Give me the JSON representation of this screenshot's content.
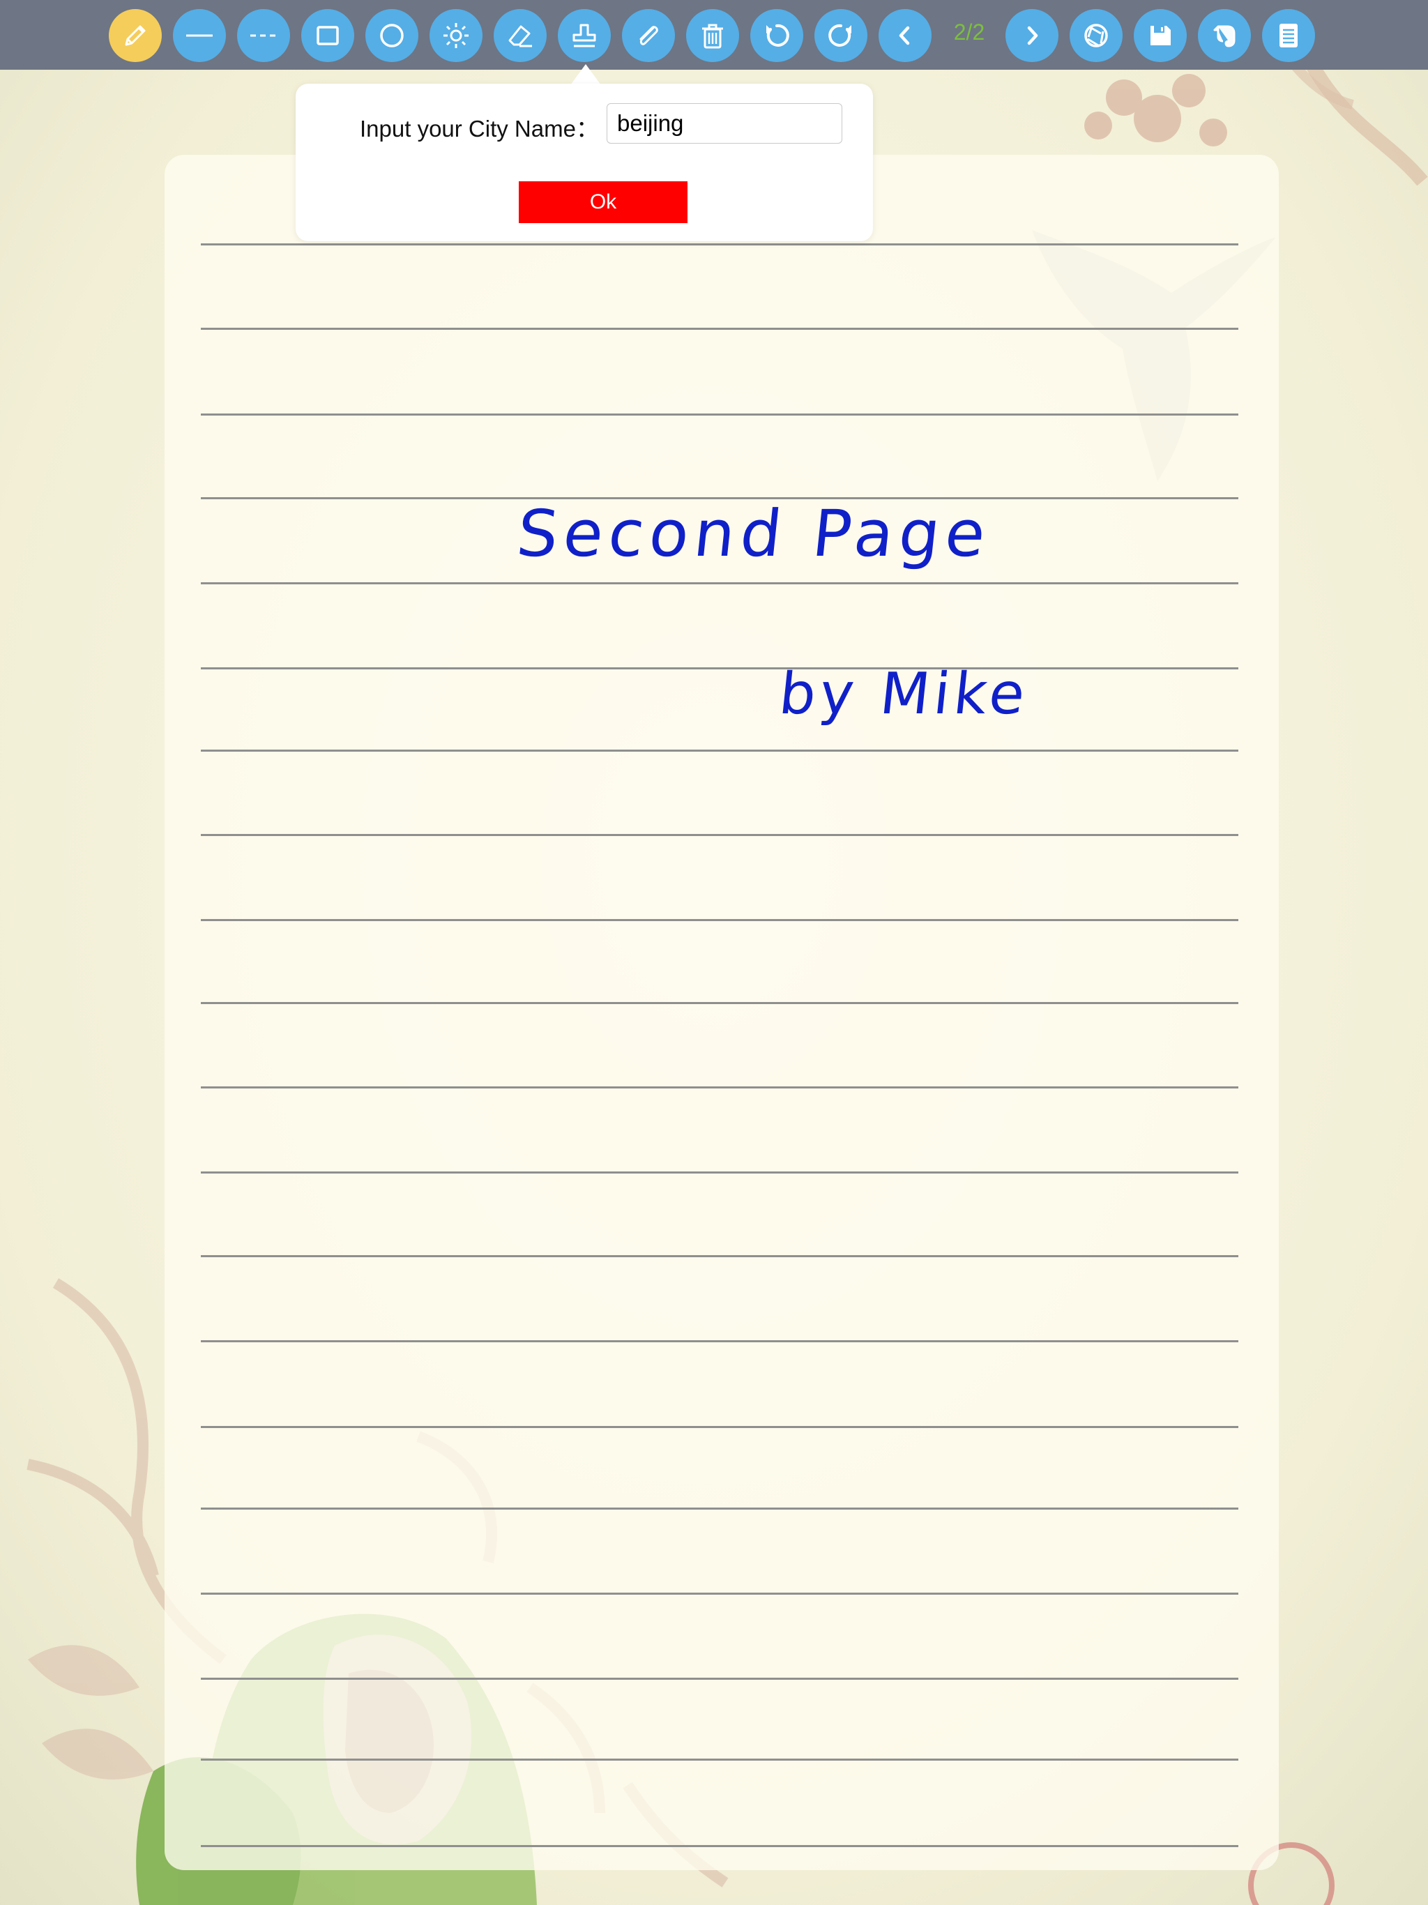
{
  "toolbar": {
    "buttons": [
      {
        "icon": "pencil-icon",
        "active": true
      },
      {
        "icon": "solid-line-icon"
      },
      {
        "icon": "dashed-line-icon"
      },
      {
        "icon": "rectangle-icon"
      },
      {
        "icon": "circle-icon"
      },
      {
        "icon": "brightness-icon"
      },
      {
        "icon": "eraser-icon"
      },
      {
        "icon": "stamp-icon"
      },
      {
        "icon": "paperclip-icon"
      },
      {
        "icon": "trash-icon"
      },
      {
        "icon": "undo-icon"
      },
      {
        "icon": "redo-icon"
      },
      {
        "icon": "chevron-left-icon"
      },
      {
        "icon": "chevron-right-icon"
      },
      {
        "icon": "camera-shutter-icon"
      },
      {
        "icon": "save-icon"
      },
      {
        "icon": "evernote-icon"
      },
      {
        "icon": "document-icon"
      }
    ],
    "page_counter": "2/2"
  },
  "dialog": {
    "label": "Input your City Name：",
    "input_value": "beijing",
    "ok_label": "Ok"
  },
  "notebook": {
    "handwriting": {
      "title": "Second Page",
      "author": "by Mike"
    }
  },
  "colors": {
    "toolbar_bg": "#6e7584",
    "button_blue": "#55aee6",
    "button_active": "#f5cd5a",
    "page_counter": "#7cbf3e",
    "ok_button": "#ff0000",
    "ink": "#1020c8",
    "ruled_line": "#8f8f8f"
  }
}
